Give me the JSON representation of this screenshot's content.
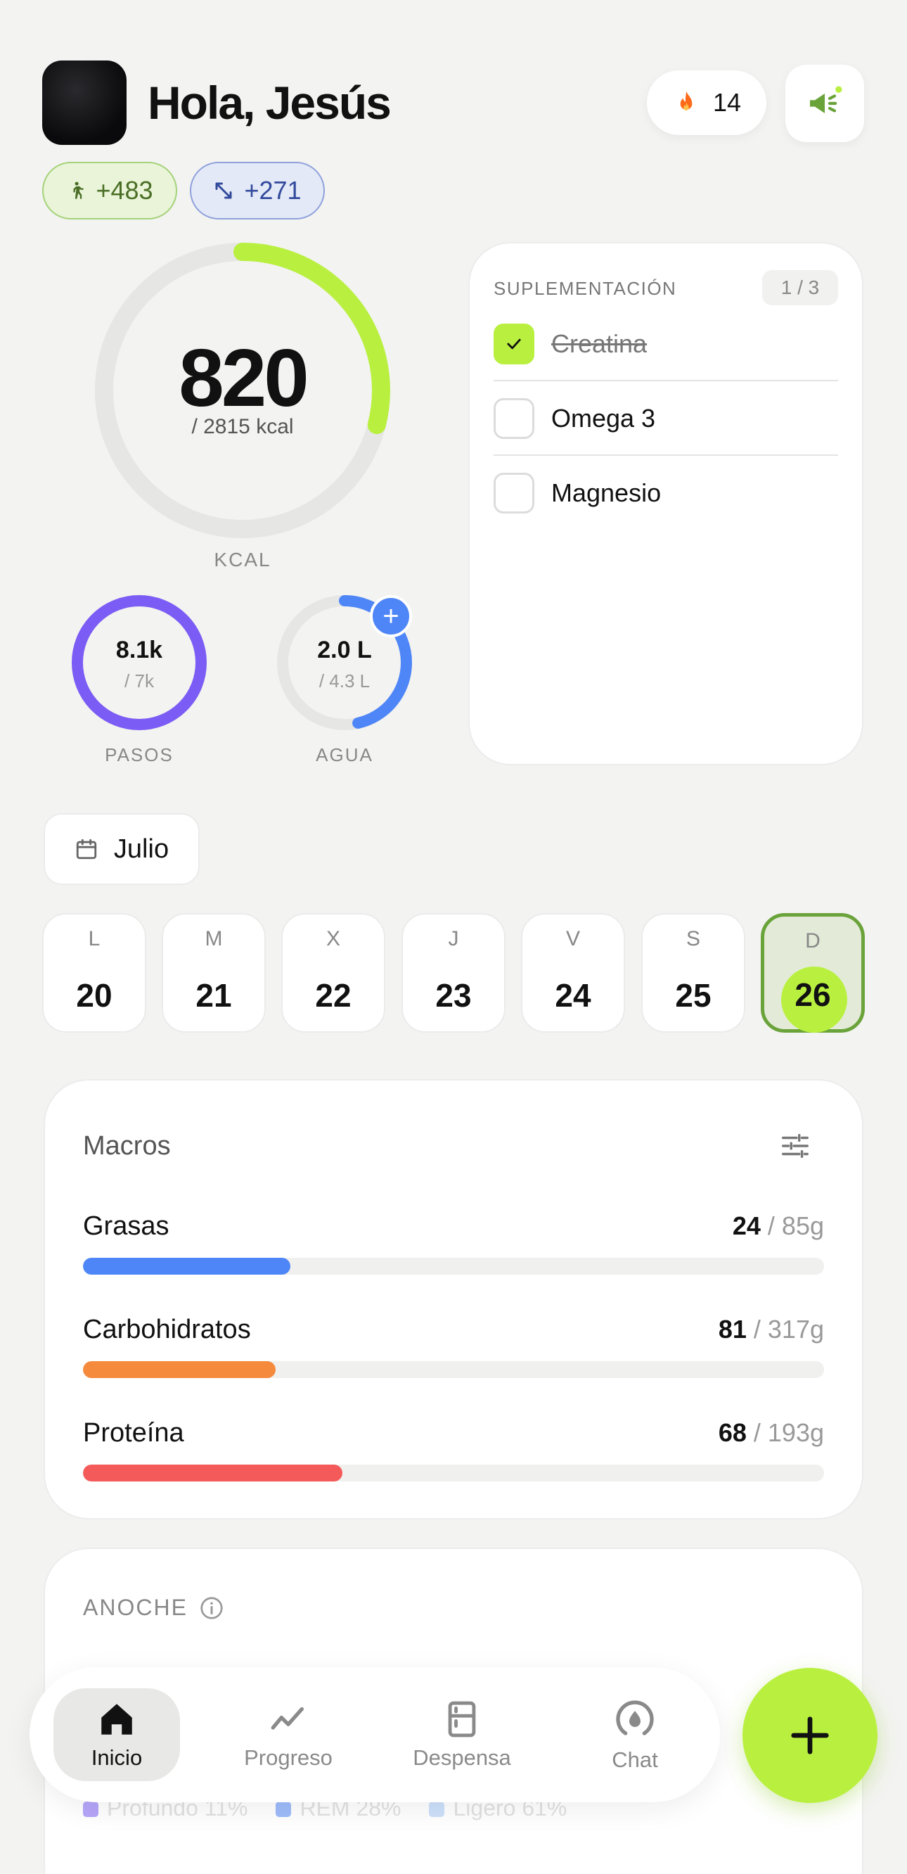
{
  "header": {
    "greeting": "Hola, Jesús",
    "streak_count": "14"
  },
  "pills": {
    "steps_delta": "+483",
    "distance_delta": "+271"
  },
  "calories": {
    "value": "820",
    "goal": "/ 2815 kcal",
    "label": "KCAL",
    "progress": 0.29
  },
  "steps": {
    "value": "8.1k",
    "goal": "/ 7k",
    "label": "PASOS",
    "progress": 1.0
  },
  "water": {
    "value": "2.0 L",
    "goal": "/ 4.3 L",
    "label": "AGUA",
    "progress": 0.465,
    "add_symbol": "+"
  },
  "supplements": {
    "title": "SUPLEMENTACIÓN",
    "count": "1 / 3",
    "items": [
      {
        "label": "Creatina",
        "checked": true
      },
      {
        "label": "Omega 3",
        "checked": false
      },
      {
        "label": "Magnesio",
        "checked": false
      }
    ]
  },
  "month": {
    "label": "Julio"
  },
  "week": [
    {
      "letter": "L",
      "day": "20"
    },
    {
      "letter": "M",
      "day": "21"
    },
    {
      "letter": "X",
      "day": "22"
    },
    {
      "letter": "J",
      "day": "23"
    },
    {
      "letter": "V",
      "day": "24"
    },
    {
      "letter": "S",
      "day": "25"
    },
    {
      "letter": "D",
      "day": "26",
      "selected": true
    }
  ],
  "macros": {
    "title": "Macros",
    "items": [
      {
        "name": "Grasas",
        "current": "24",
        "goal": "/ 85g",
        "progress": 0.28,
        "color": "#4f86f7"
      },
      {
        "name": "Carbohidratos",
        "current": "81",
        "goal": "/ 317g",
        "progress": 0.26,
        "color": "#f58a3d"
      },
      {
        "name": "Proteína",
        "current": "68",
        "goal": "/ 193g",
        "progress": 0.35,
        "color": "#f55a5a"
      }
    ]
  },
  "sleep": {
    "title": "ANOCHE",
    "legend": [
      "Profundo 11%",
      "REM 28%",
      "Ligero 61%"
    ]
  },
  "nav": {
    "items": [
      "Inicio",
      "Progreso",
      "Despensa",
      "Chat"
    ],
    "active": "Inicio"
  },
  "colors": {
    "accent": "#b9f040",
    "ring_track": "#e6e6e4",
    "steps": "#7b5cf5",
    "water": "#4f86f7"
  }
}
